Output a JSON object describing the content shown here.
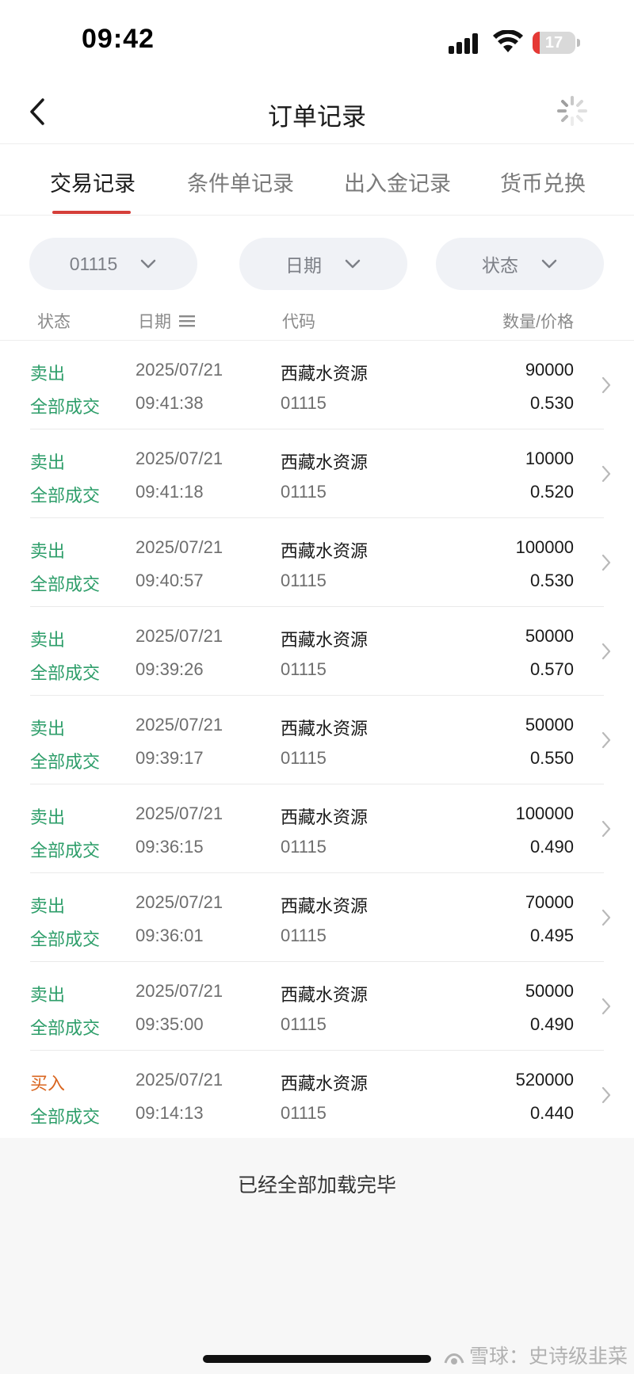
{
  "status_bar": {
    "time": "09:42",
    "battery_level": "17",
    "battery_fraction": 0.17
  },
  "nav": {
    "title": "订单记录",
    "back_icon": "chevron-left-icon",
    "right_icon": "loading-spinner-icon"
  },
  "tabs": [
    {
      "label": "交易记录",
      "active": true
    },
    {
      "label": "条件单记录",
      "active": false
    },
    {
      "label": "出入金记录",
      "active": false
    },
    {
      "label": "货币兑换",
      "active": false
    }
  ],
  "filters": {
    "code": "01115",
    "date": "日期",
    "status": "状态"
  },
  "columns": {
    "status": "状态",
    "date": "日期",
    "code": "代码",
    "qty_price": "数量/价格"
  },
  "orders": [
    {
      "side": "卖出",
      "status": "全部成交",
      "date": "2025/07/21",
      "time": "09:41:38",
      "name": "西藏水资源",
      "code": "01115",
      "qty": "90000",
      "price": "0.530"
    },
    {
      "side": "卖出",
      "status": "全部成交",
      "date": "2025/07/21",
      "time": "09:41:18",
      "name": "西藏水资源",
      "code": "01115",
      "qty": "10000",
      "price": "0.520"
    },
    {
      "side": "卖出",
      "status": "全部成交",
      "date": "2025/07/21",
      "time": "09:40:57",
      "name": "西藏水资源",
      "code": "01115",
      "qty": "100000",
      "price": "0.530"
    },
    {
      "side": "卖出",
      "status": "全部成交",
      "date": "2025/07/21",
      "time": "09:39:26",
      "name": "西藏水资源",
      "code": "01115",
      "qty": "50000",
      "price": "0.570"
    },
    {
      "side": "卖出",
      "status": "全部成交",
      "date": "2025/07/21",
      "time": "09:39:17",
      "name": "西藏水资源",
      "code": "01115",
      "qty": "50000",
      "price": "0.550"
    },
    {
      "side": "卖出",
      "status": "全部成交",
      "date": "2025/07/21",
      "time": "09:36:15",
      "name": "西藏水资源",
      "code": "01115",
      "qty": "100000",
      "price": "0.490"
    },
    {
      "side": "卖出",
      "status": "全部成交",
      "date": "2025/07/21",
      "time": "09:36:01",
      "name": "西藏水资源",
      "code": "01115",
      "qty": "70000",
      "price": "0.495"
    },
    {
      "side": "卖出",
      "status": "全部成交",
      "date": "2025/07/21",
      "time": "09:35:00",
      "name": "西藏水资源",
      "code": "01115",
      "qty": "50000",
      "price": "0.490"
    },
    {
      "side": "买入",
      "status": "全部成交",
      "date": "2025/07/21",
      "time": "09:14:13",
      "name": "西藏水资源",
      "code": "01115",
      "qty": "520000",
      "price": "0.440"
    }
  ],
  "footer": {
    "load_done": "已经全部加载完毕"
  },
  "watermark": "雪球：史诗级韭菜",
  "colors": {
    "accent_red": "#d53f3a",
    "sell_green": "#2e9e6a",
    "buy_orange": "#d9651f"
  }
}
